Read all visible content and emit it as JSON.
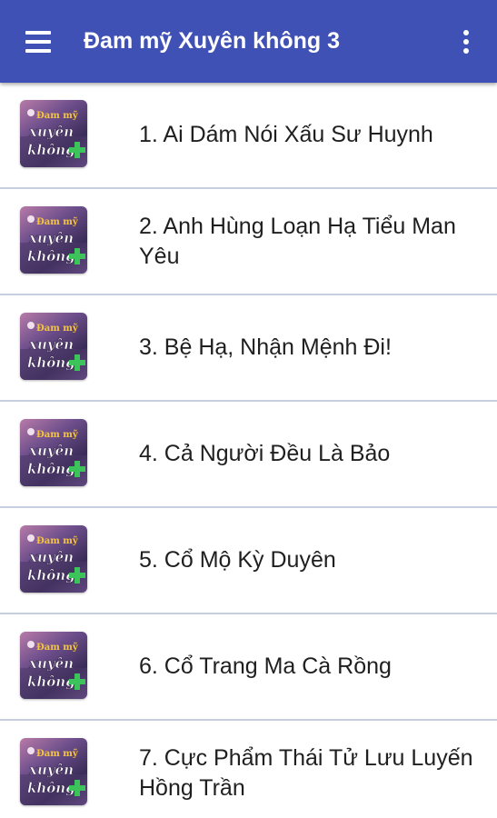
{
  "app_bar": {
    "title": "Đam mỹ Xuyên không 3",
    "menu_icon": "hamburger-menu-icon",
    "overflow_icon": "more-vert-icon",
    "color": "#3f51b5"
  },
  "thumbnail": {
    "line1": "Đam mỹ",
    "line2": "xuyên",
    "line3": "không"
  },
  "stories": [
    {
      "title": "1. Ai Dám Nói Xấu Sư Huynh"
    },
    {
      "title": "2. Anh Hùng Loạn Hạ Tiểu Man Yêu"
    },
    {
      "title": "3. Bệ Hạ, Nhận Mệnh Đi!"
    },
    {
      "title": "4. Cả Người Đều Là Bảo"
    },
    {
      "title": "5. Cổ Mộ Kỳ Duyên"
    },
    {
      "title": "6. Cổ Trang Ma Cà Rồng"
    },
    {
      "title": "7. Cực Phẩm Thái Tử Lưu Luyến Hồng Trần"
    }
  ]
}
